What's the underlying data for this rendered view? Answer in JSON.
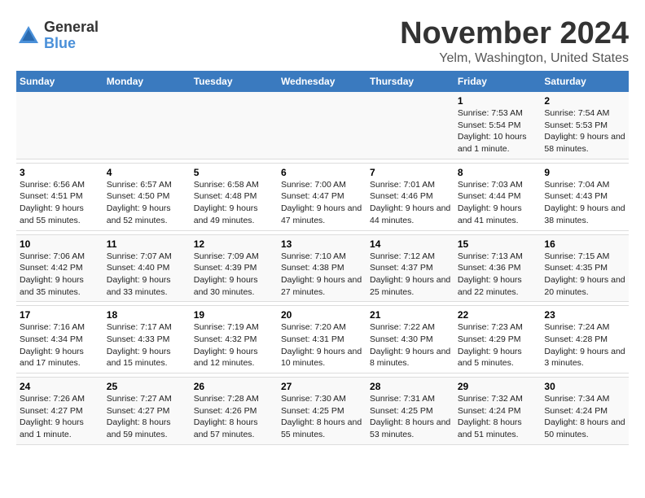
{
  "logo": {
    "general": "General",
    "blue": "Blue"
  },
  "title": "November 2024",
  "subtitle": "Yelm, Washington, United States",
  "days_header": [
    "Sunday",
    "Monday",
    "Tuesday",
    "Wednesday",
    "Thursday",
    "Friday",
    "Saturday"
  ],
  "weeks": [
    {
      "cells": [
        {
          "day": "",
          "info": ""
        },
        {
          "day": "",
          "info": ""
        },
        {
          "day": "",
          "info": ""
        },
        {
          "day": "",
          "info": ""
        },
        {
          "day": "",
          "info": ""
        },
        {
          "day": "1",
          "info": "Sunrise: 7:53 AM\nSunset: 5:54 PM\nDaylight: 10 hours and 1 minute."
        },
        {
          "day": "2",
          "info": "Sunrise: 7:54 AM\nSunset: 5:53 PM\nDaylight: 9 hours and 58 minutes."
        }
      ]
    },
    {
      "cells": [
        {
          "day": "3",
          "info": "Sunrise: 6:56 AM\nSunset: 4:51 PM\nDaylight: 9 hours and 55 minutes."
        },
        {
          "day": "4",
          "info": "Sunrise: 6:57 AM\nSunset: 4:50 PM\nDaylight: 9 hours and 52 minutes."
        },
        {
          "day": "5",
          "info": "Sunrise: 6:58 AM\nSunset: 4:48 PM\nDaylight: 9 hours and 49 minutes."
        },
        {
          "day": "6",
          "info": "Sunrise: 7:00 AM\nSunset: 4:47 PM\nDaylight: 9 hours and 47 minutes."
        },
        {
          "day": "7",
          "info": "Sunrise: 7:01 AM\nSunset: 4:46 PM\nDaylight: 9 hours and 44 minutes."
        },
        {
          "day": "8",
          "info": "Sunrise: 7:03 AM\nSunset: 4:44 PM\nDaylight: 9 hours and 41 minutes."
        },
        {
          "day": "9",
          "info": "Sunrise: 7:04 AM\nSunset: 4:43 PM\nDaylight: 9 hours and 38 minutes."
        }
      ]
    },
    {
      "cells": [
        {
          "day": "10",
          "info": "Sunrise: 7:06 AM\nSunset: 4:42 PM\nDaylight: 9 hours and 35 minutes."
        },
        {
          "day": "11",
          "info": "Sunrise: 7:07 AM\nSunset: 4:40 PM\nDaylight: 9 hours and 33 minutes."
        },
        {
          "day": "12",
          "info": "Sunrise: 7:09 AM\nSunset: 4:39 PM\nDaylight: 9 hours and 30 minutes."
        },
        {
          "day": "13",
          "info": "Sunrise: 7:10 AM\nSunset: 4:38 PM\nDaylight: 9 hours and 27 minutes."
        },
        {
          "day": "14",
          "info": "Sunrise: 7:12 AM\nSunset: 4:37 PM\nDaylight: 9 hours and 25 minutes."
        },
        {
          "day": "15",
          "info": "Sunrise: 7:13 AM\nSunset: 4:36 PM\nDaylight: 9 hours and 22 minutes."
        },
        {
          "day": "16",
          "info": "Sunrise: 7:15 AM\nSunset: 4:35 PM\nDaylight: 9 hours and 20 minutes."
        }
      ]
    },
    {
      "cells": [
        {
          "day": "17",
          "info": "Sunrise: 7:16 AM\nSunset: 4:34 PM\nDaylight: 9 hours and 17 minutes."
        },
        {
          "day": "18",
          "info": "Sunrise: 7:17 AM\nSunset: 4:33 PM\nDaylight: 9 hours and 15 minutes."
        },
        {
          "day": "19",
          "info": "Sunrise: 7:19 AM\nSunset: 4:32 PM\nDaylight: 9 hours and 12 minutes."
        },
        {
          "day": "20",
          "info": "Sunrise: 7:20 AM\nSunset: 4:31 PM\nDaylight: 9 hours and 10 minutes."
        },
        {
          "day": "21",
          "info": "Sunrise: 7:22 AM\nSunset: 4:30 PM\nDaylight: 9 hours and 8 minutes."
        },
        {
          "day": "22",
          "info": "Sunrise: 7:23 AM\nSunset: 4:29 PM\nDaylight: 9 hours and 5 minutes."
        },
        {
          "day": "23",
          "info": "Sunrise: 7:24 AM\nSunset: 4:28 PM\nDaylight: 9 hours and 3 minutes."
        }
      ]
    },
    {
      "cells": [
        {
          "day": "24",
          "info": "Sunrise: 7:26 AM\nSunset: 4:27 PM\nDaylight: 9 hours and 1 minute."
        },
        {
          "day": "25",
          "info": "Sunrise: 7:27 AM\nSunset: 4:27 PM\nDaylight: 8 hours and 59 minutes."
        },
        {
          "day": "26",
          "info": "Sunrise: 7:28 AM\nSunset: 4:26 PM\nDaylight: 8 hours and 57 minutes."
        },
        {
          "day": "27",
          "info": "Sunrise: 7:30 AM\nSunset: 4:25 PM\nDaylight: 8 hours and 55 minutes."
        },
        {
          "day": "28",
          "info": "Sunrise: 7:31 AM\nSunset: 4:25 PM\nDaylight: 8 hours and 53 minutes."
        },
        {
          "day": "29",
          "info": "Sunrise: 7:32 AM\nSunset: 4:24 PM\nDaylight: 8 hours and 51 minutes."
        },
        {
          "day": "30",
          "info": "Sunrise: 7:34 AM\nSunset: 4:24 PM\nDaylight: 8 hours and 50 minutes."
        }
      ]
    }
  ]
}
